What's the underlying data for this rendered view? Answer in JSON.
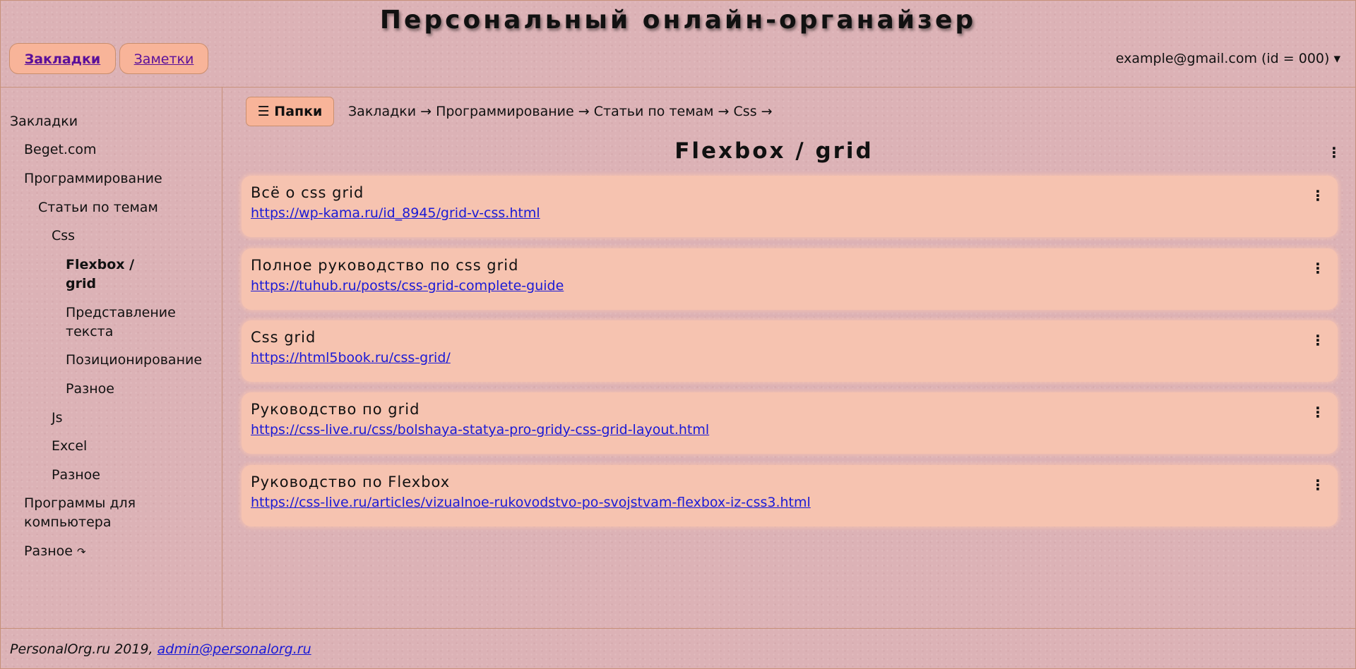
{
  "header": {
    "title": "Персональный онлайн-органайзер",
    "tabs": [
      {
        "label": "Закладки"
      },
      {
        "label": "Заметки"
      }
    ],
    "account": "example@gmail.com (id = 000) ▾"
  },
  "sidebar": {
    "items": [
      {
        "label": "Закладки"
      },
      {
        "label": "Beget.com"
      },
      {
        "label": "Программирование"
      },
      {
        "label": "Статьи по темам"
      },
      {
        "label": "Css"
      },
      {
        "label": "Flexbox / grid"
      },
      {
        "label": "Представление текста"
      },
      {
        "label": "Позиционирование"
      },
      {
        "label": "Разное"
      },
      {
        "label": "Js"
      },
      {
        "label": "Excel"
      },
      {
        "label": "Разное"
      },
      {
        "label": "Программы для компьютера"
      },
      {
        "label": "Разное",
        "icon": "↷"
      }
    ]
  },
  "main": {
    "folders_button": "☰ Папки",
    "breadcrumb": [
      "Закладки →",
      "Программирование →",
      "Статьи по темам →",
      "Css →"
    ],
    "folder_title": "Flexbox / grid",
    "menu_icon": "⋮",
    "bookmarks": [
      {
        "title": "Всё о css grid",
        "url": "https://wp-kama.ru/id_8945/grid-v-css.html"
      },
      {
        "title": "Полное руководство по css grid",
        "url": "https://tuhub.ru/posts/css-grid-complete-guide"
      },
      {
        "title": "Css grid",
        "url": "https://html5book.ru/css-grid/"
      },
      {
        "title": "Руководство по grid",
        "url": "https://css-live.ru/css/bolshaya-statya-pro-gridy-css-grid-layout.html"
      },
      {
        "title": "Руководство по Flexbox",
        "url": "https://css-live.ru/articles/vizualnoe-rukovodstvo-po-svojstvam-flexbox-iz-css3.html"
      }
    ]
  },
  "footer": {
    "text": "PersonalOrg.ru 2019, ",
    "email": "admin@personalorg.ru"
  },
  "colors": {
    "background": "#dcb2b6",
    "button": "#f8b499",
    "card": "#f6c3b0",
    "link": "#1a1ad6",
    "border": "#c7917a"
  }
}
